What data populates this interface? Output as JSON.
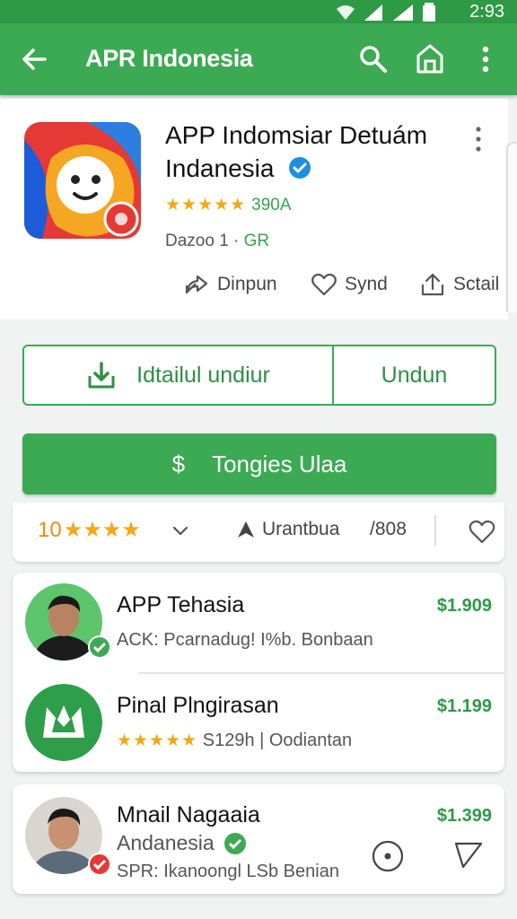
{
  "status": {
    "time": "2:93"
  },
  "appbar": {
    "title": "APR Indonesia",
    "icons": [
      "back-arrow-icon",
      "search-icon",
      "store-icon",
      "more-vert-icon"
    ]
  },
  "app": {
    "name": "APP Indomsiar Detuám Indanesia",
    "rating_count": "390A",
    "meta_prefix": "Dazoo 1 · ",
    "meta_dev": "GR",
    "actions": [
      {
        "label": "Dinpun",
        "icon": "share-icon"
      },
      {
        "label": "Synd",
        "icon": "heart-icon"
      },
      {
        "label": "Sctail",
        "icon": "upload-icon"
      }
    ]
  },
  "buttons": {
    "primary_left": "Idtailul undiur",
    "primary_right": "Undun",
    "cta": "Tongies Ulaa",
    "cta_symbol": "$"
  },
  "stats": {
    "score": "10",
    "category": "Urantbua",
    "count": "/808"
  },
  "list": [
    {
      "name": "APP Tehasia",
      "sub": "ACK: Pcarnadug! I%b. Bonbaan",
      "price": "$1.909"
    },
    {
      "name": "Pinal Plngirasan",
      "sub": "S129h | Oodiantan",
      "price": "$1.199"
    },
    {
      "name": "Mnail Nagaaia",
      "line2": "Andanesia",
      "sub": "SPR: Ikanoongl LSb Benian",
      "price": "$1.399"
    }
  ],
  "colors": {
    "brand_green": "#3caa52",
    "star": "#f2a817",
    "verified_blue": "#1e8fe0"
  }
}
